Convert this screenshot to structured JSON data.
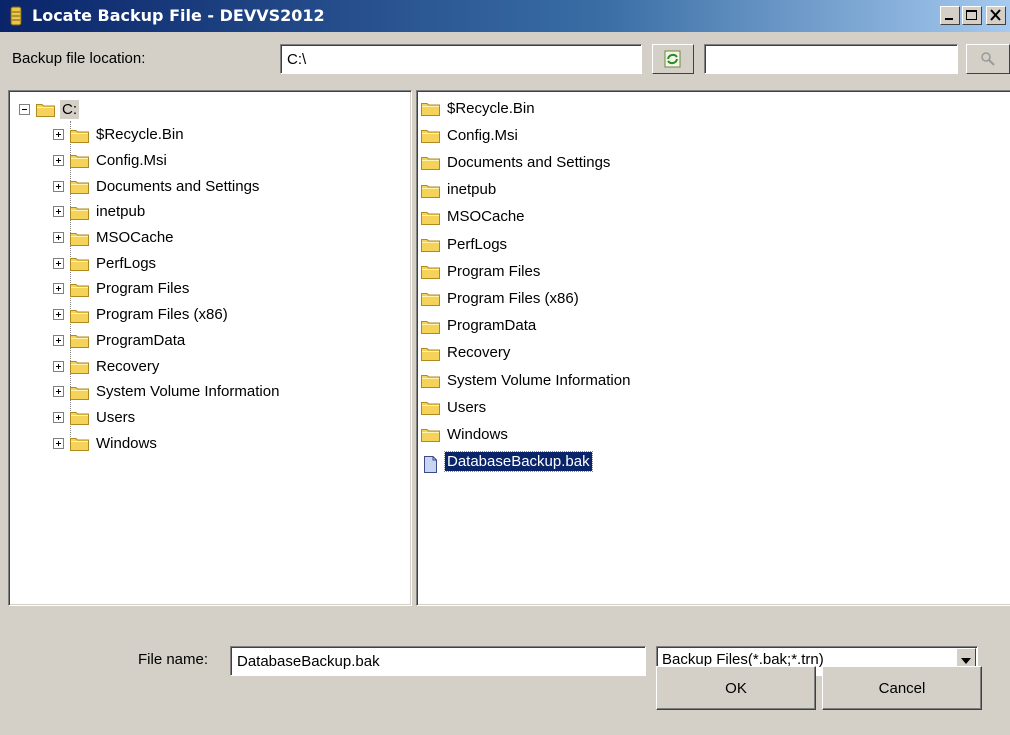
{
  "window": {
    "title": "Locate Backup File - DEVVS2012",
    "icon": "backup-file-icon",
    "controls": [
      "minimize-icon",
      "maximize-icon",
      "close-icon"
    ]
  },
  "location": {
    "label": "Backup file location:",
    "value": "C:\\",
    "refresh_icon": "refresh-icon",
    "search_value": "",
    "search_icon": "search-icon"
  },
  "tree": {
    "root": "C:",
    "items": [
      "$Recycle.Bin",
      "Config.Msi",
      "Documents and Settings",
      "inetpub",
      "MSOCache",
      "PerfLogs",
      "Program Files",
      "Program Files (x86)",
      "ProgramData",
      "Recovery",
      "System Volume Information",
      "Users",
      "Windows"
    ]
  },
  "files": {
    "items": [
      {
        "name": "$Recycle.Bin",
        "icon": "folder-icon"
      },
      {
        "name": "Config.Msi",
        "icon": "folder-icon"
      },
      {
        "name": "Documents and Settings",
        "icon": "folder-icon"
      },
      {
        "name": "inetpub",
        "icon": "folder-icon"
      },
      {
        "name": "MSOCache",
        "icon": "folder-icon"
      },
      {
        "name": "PerfLogs",
        "icon": "folder-icon"
      },
      {
        "name": "Program Files",
        "icon": "folder-icon"
      },
      {
        "name": "Program Files (x86)",
        "icon": "folder-icon"
      },
      {
        "name": "ProgramData",
        "icon": "folder-icon"
      },
      {
        "name": "Recovery",
        "icon": "folder-icon"
      },
      {
        "name": "System Volume Information",
        "icon": "folder-icon"
      },
      {
        "name": "Users",
        "icon": "folder-icon"
      },
      {
        "name": "Windows",
        "icon": "folder-icon"
      },
      {
        "name": "DatabaseBackup.bak",
        "icon": "file-icon",
        "selected": true
      }
    ]
  },
  "bottom": {
    "file_name_label": "File name:",
    "file_name_value": "DatabaseBackup.bak",
    "filter_value": "Backup Files(*.bak;*.trn)",
    "ok_label": "OK",
    "cancel_label": "Cancel"
  },
  "colors": {
    "titlebar": "#0a246a",
    "selection": "#0a246a",
    "folder": "#f5d25a",
    "face": "#d4d0c8"
  }
}
